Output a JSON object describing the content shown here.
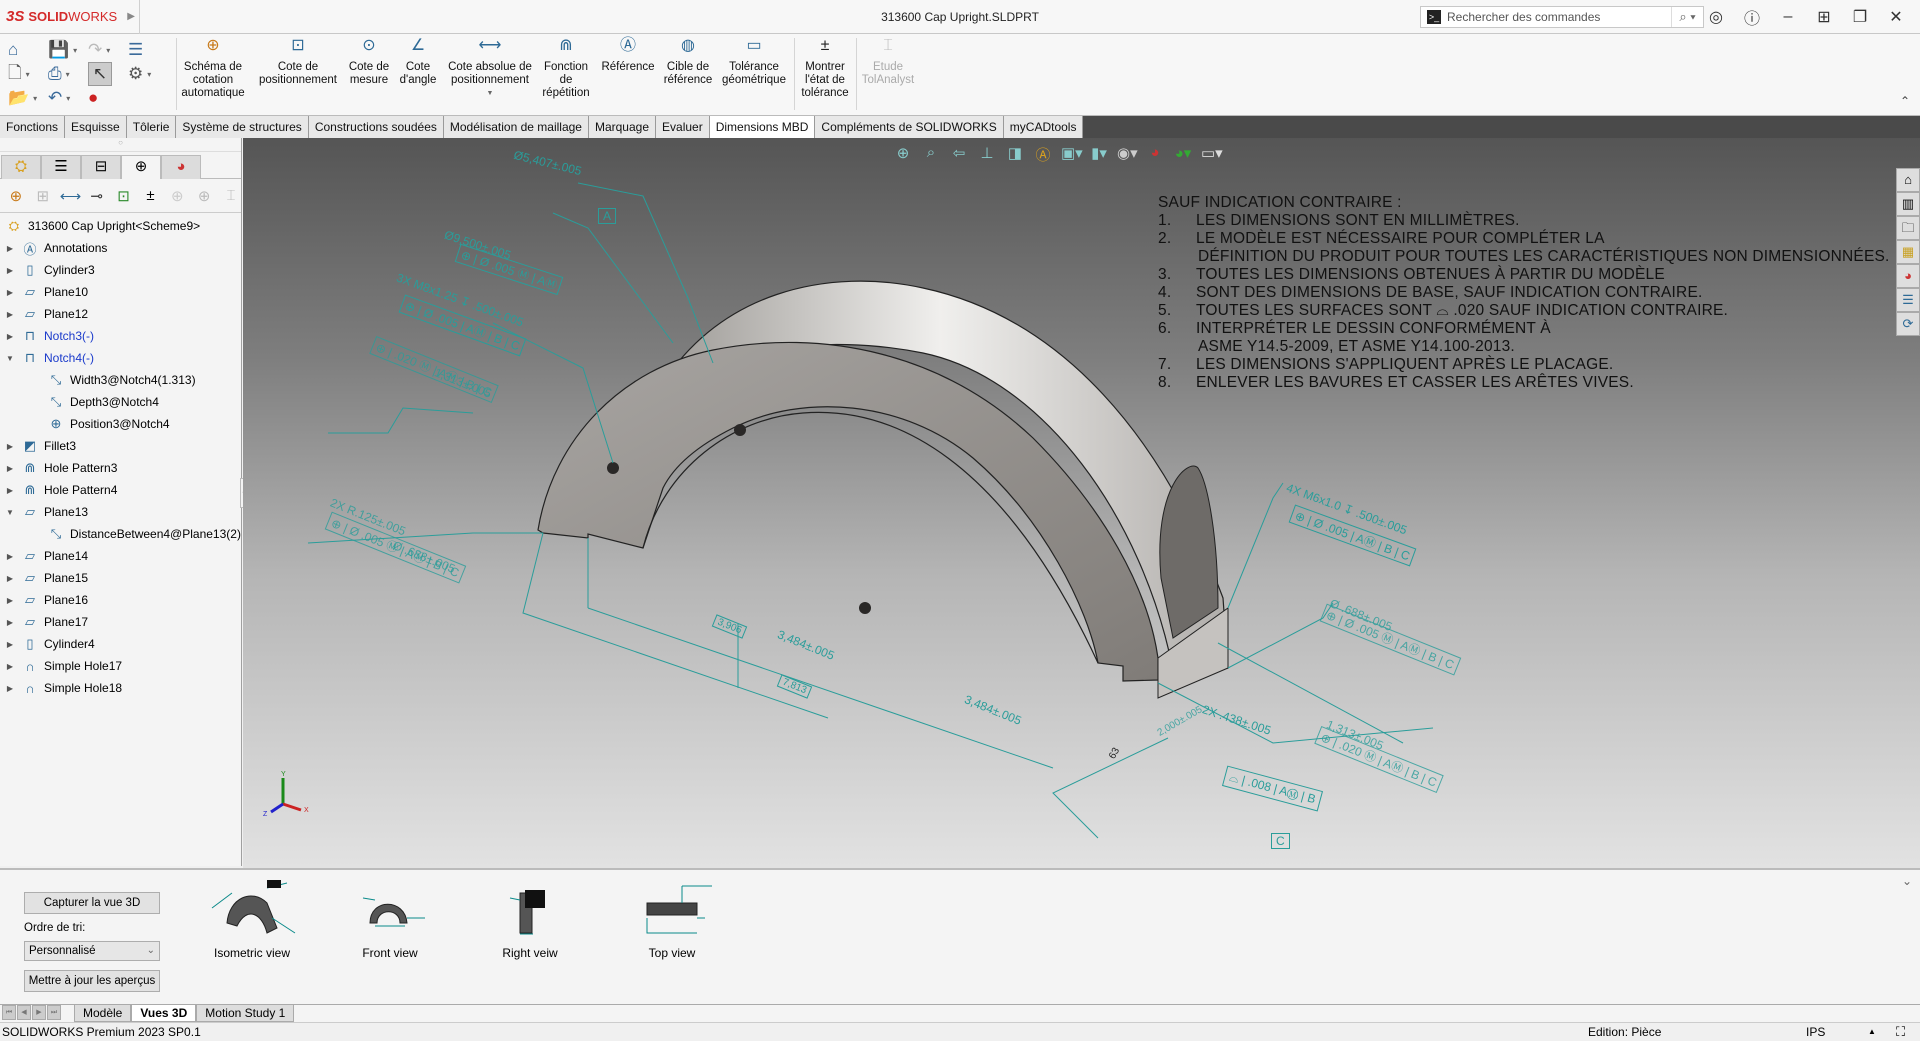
{
  "app": {
    "logo_ds": "3S",
    "logo_brand_bold": "SOLID",
    "logo_brand_light": "WORKS",
    "document_title": "313600 Cap Upright.SLDPRT"
  },
  "search": {
    "placeholder": "Rechercher des commandes"
  },
  "window_controls": [
    "user-icon",
    "help-icon",
    "minimize-icon",
    "tile-icon",
    "restore-icon",
    "close-icon"
  ],
  "ribbon": {
    "commands": [
      {
        "label": "Schéma de\ncotation\nautomatique",
        "icon": "auto-dimension-scheme-icon"
      },
      {
        "label": "Cote de\npositionnement",
        "icon": "location-dimension-icon"
      },
      {
        "label": "Cote de\nmesure",
        "icon": "size-dimension-icon"
      },
      {
        "label": "Cote\nd'angle",
        "icon": "angle-dimension-icon"
      },
      {
        "label": "Cote absolue de\npositionnement",
        "icon": "datum-dimension-icon"
      },
      {
        "label": "Fonction\nde\nrépétition",
        "icon": "pattern-feature-icon"
      },
      {
        "label": "Référence",
        "icon": "datum-icon"
      },
      {
        "label": "Cible de\nréférence",
        "icon": "datum-target-icon"
      },
      {
        "label": "Tolérance\ngéométrique",
        "icon": "geometric-tolerance-icon"
      },
      {
        "label": "Montrer\nl'état de\ntolérance",
        "icon": "show-tolerance-status-icon"
      },
      {
        "label": "Etude\nTolAnalyst",
        "icon": "tolanalyst-icon",
        "disabled": true
      }
    ]
  },
  "tabs": [
    {
      "label": "Fonctions"
    },
    {
      "label": "Esquisse"
    },
    {
      "label": "Tôlerie"
    },
    {
      "label": "Système de structures"
    },
    {
      "label": "Constructions soudées"
    },
    {
      "label": "Modélisation de maillage"
    },
    {
      "label": "Marquage"
    },
    {
      "label": "Evaluer"
    },
    {
      "label": "Dimensions MBD",
      "active": true
    },
    {
      "label": "Compléments de SOLIDWORKS"
    },
    {
      "label": "myCADtools"
    }
  ],
  "feature_tree": {
    "root": "313600 Cap Upright<Scheme9>",
    "items": [
      {
        "label": "Annotations",
        "icon": "annotations-folder-icon",
        "expand": "collapsed"
      },
      {
        "label": "Cylinder3",
        "icon": "cylinder-icon",
        "expand": "collapsed"
      },
      {
        "label": "Plane10",
        "icon": "plane-icon",
        "expand": "collapsed"
      },
      {
        "label": "Plane12",
        "icon": "plane-icon",
        "expand": "collapsed"
      },
      {
        "label": "Notch3(-)",
        "icon": "notch-icon",
        "expand": "collapsed",
        "highlight": true
      },
      {
        "label": "Notch4(-)",
        "icon": "notch-icon",
        "expand": "expanded",
        "highlight": true
      },
      {
        "label": "Width3@Notch4(1.313)",
        "icon": "dimension-icon",
        "child": true
      },
      {
        "label": "Depth3@Notch4",
        "icon": "dimension-icon",
        "child": true
      },
      {
        "label": "Position3@Notch4",
        "icon": "position-icon",
        "child": true
      },
      {
        "label": "Fillet3",
        "icon": "fillet-icon",
        "expand": "collapsed"
      },
      {
        "label": "Hole Pattern3",
        "icon": "hole-pattern-icon",
        "expand": "collapsed"
      },
      {
        "label": "Hole Pattern4",
        "icon": "hole-pattern-icon",
        "expand": "collapsed"
      },
      {
        "label": "Plane13",
        "icon": "plane-icon",
        "expand": "expanded"
      },
      {
        "label": "DistanceBetween4@Plane13(2)",
        "icon": "dimension-icon",
        "child": true
      },
      {
        "label": "Plane14",
        "icon": "plane-icon",
        "expand": "collapsed"
      },
      {
        "label": "Plane15",
        "icon": "plane-icon",
        "expand": "collapsed"
      },
      {
        "label": "Plane16",
        "icon": "plane-icon",
        "expand": "collapsed"
      },
      {
        "label": "Plane17",
        "icon": "plane-icon",
        "expand": "collapsed"
      },
      {
        "label": "Cylinder4",
        "icon": "cylinder-icon",
        "expand": "collapsed"
      },
      {
        "label": "Simple Hole17",
        "icon": "simple-hole-icon",
        "expand": "collapsed"
      },
      {
        "label": "Simple Hole18",
        "icon": "simple-hole-icon",
        "expand": "collapsed"
      }
    ]
  },
  "notes": {
    "header": "SAUF INDICATION CONTRAIRE :",
    "lines": [
      {
        "n": "1.",
        "text": "LES DIMENSIONS SONT EN MILLIMÈTRES."
      },
      {
        "n": "2.",
        "text": "LE MODÈLE EST NÉCESSAIRE POUR COMPLÉTER LA"
      },
      {
        "n": "",
        "text": "DÉFINITION DU PRODUIT POUR TOUTES LES CARACTÉRISTIQUES NON DIMENSIONNÉES."
      },
      {
        "n": "3.",
        "text": "TOUTES LES DIMENSIONS OBTENUES À PARTIR DU MODÈLE"
      },
      {
        "n": "4.",
        "text": "SONT DES DIMENSIONS DE BASE, SAUF INDICATION CONTRAIRE."
      },
      {
        "n": "5.",
        "text": "TOUTES LES SURFACES SONT ⌓ .020 SAUF INDICATION CONTRAIRE."
      },
      {
        "n": "6.",
        "text": "INTERPRÉTER LE DESSIN CONFORMÉMENT À"
      },
      {
        "n": "",
        "text": "ASME Y14.5-2009, ET ASME Y14.100-2013."
      },
      {
        "n": "7.",
        "text": "LES DIMENSIONS S'APPLIQUENT APRÈS LE PLACAGE."
      },
      {
        "n": "8.",
        "text": "ENLEVER LES BAVURES ET CASSER LES ARÊTES VIVES."
      }
    ]
  },
  "annotations": {
    "d1": "Ø5,407±.005",
    "datum_a": "A",
    "d2": "Ø9,500±.005",
    "fcf2": "⊕ | Ø .005 Ⓜ | AⓂ",
    "d3": "3X M8x1.25 ↧ .500±.005",
    "fcf3": "⊕ | Ø .005 | AⓂ | B | C",
    "d4": "1,313±.005",
    "fcf4": "⊕ | .020 Ⓜ | AⓂ | B | C",
    "d5": "2X R.125±.005",
    "d6": "Ø .688±.005",
    "fcf6": "⊕ | Ø .005 Ⓜ | AⓂ | B | C",
    "d7": "3,906",
    "d8": "3,484±.005",
    "d9": "7,813",
    "d10": "3,484±.005",
    "d11": "4X M6x1.0 ↧ .500±.005",
    "fcf11": "⊕ | Ø .005 | AⓂ | B | C",
    "d12": "Ø .688±.005",
    "fcf12": "⊕ | Ø .005 Ⓜ | AⓂ | B | C",
    "d13": "1,313±.005",
    "fcf13": "⊕ | .020 Ⓜ | AⓂ | B | C",
    "d14": "2X .438±.005",
    "d15": "2,000±.005",
    "d16": "63",
    "fcf17": "⌓ | .008 | AⓂ | B",
    "datum_c": "C"
  },
  "triad": {
    "x": "X",
    "y": "Y",
    "z": "Z"
  },
  "views_panel": {
    "capture_button": "Capturer la vue 3D",
    "sort_label": "Ordre de tri:",
    "sort_value": "Personnalisé",
    "update_button": "Mettre à jour les aperçus",
    "views": [
      {
        "label": "Isometric view"
      },
      {
        "label": "Front view"
      },
      {
        "label": "Right veiw"
      },
      {
        "label": "Top view"
      }
    ]
  },
  "sheet_tabs": [
    {
      "label": "Modèle"
    },
    {
      "label": "Vues 3D",
      "active": true
    },
    {
      "label": "Motion Study 1"
    }
  ],
  "status": {
    "version": "SOLIDWORKS Premium 2023 SP0.1",
    "edit_mode": "Edition: Pièce",
    "units": "IPS"
  },
  "colors": {
    "annotation": "#2a9d9a",
    "brand": "#d42a2a",
    "highlight_feature": "#1a3acb"
  }
}
